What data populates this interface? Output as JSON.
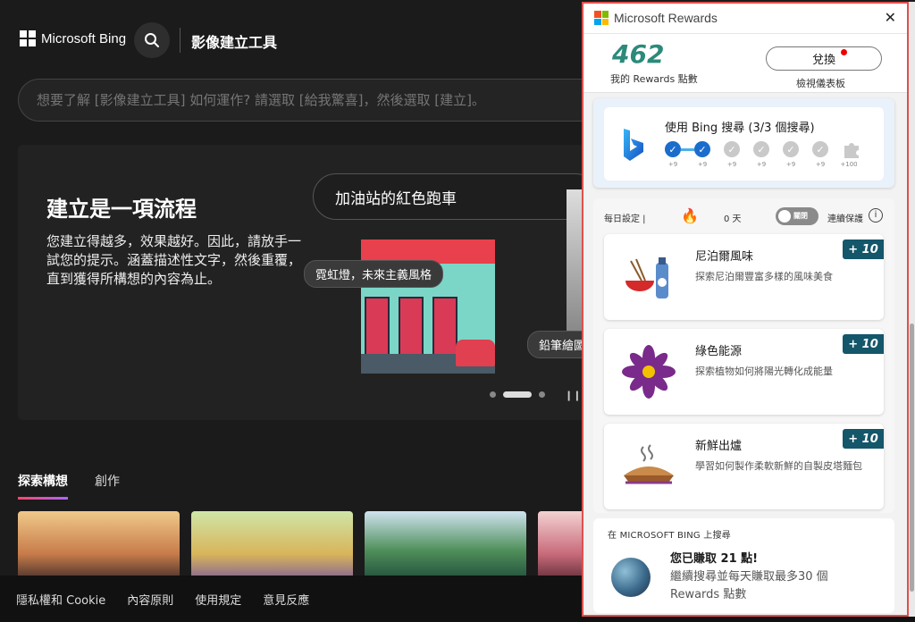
{
  "bing": {
    "logo_text": "Microsoft Bing",
    "tool_title": "影像建立工具",
    "prompt_placeholder": "想要了解 [影像建立工具] 如何運作? 請選取 [給我驚喜]，然後選取 [建立]。",
    "hero": {
      "title": "建立是一項流程",
      "description": "您建立得越多，效果越好。因此，請放手一試您的提示。涵蓋描述性文字，然後重覆，直到獲得所構想的內容為止。",
      "example_prompt": "加油站的紅色跑車",
      "chip_style": "霓虹燈，未來主義風格",
      "chip_style2": "鉛筆繪圖"
    },
    "tabs": [
      "探索構想",
      "創作"
    ],
    "footer": [
      "隱私權和 Cookie",
      "內容原則",
      "使用規定",
      "意見反應"
    ]
  },
  "rewards": {
    "title": "Microsoft Rewards",
    "points": "462",
    "points_label": "我的 Rewards 點數",
    "redeem_label": "兌換",
    "dashboard_label": "檢視儀表板",
    "search_card": {
      "title": "使用 Bing 搜尋 (3/3 個搜尋)",
      "steps_done": 2,
      "step_labels": [
        "+9",
        "+9",
        "+9",
        "+9",
        "+9",
        "+9",
        "+100"
      ]
    },
    "streak": {
      "label": "每日設定 |",
      "days": "0 天",
      "toggle_label": "關閉",
      "protection_label": "連續保護"
    },
    "offers": [
      {
        "badge": "+ 10",
        "title": "尼泊爾風味",
        "desc": "探索尼泊爾豐富多樣的風味美食"
      },
      {
        "badge": "+ 10",
        "title": "綠色能源",
        "desc": "探索植物如何將陽光轉化成能量"
      },
      {
        "badge": "+ 10",
        "title": "新鮮出爐",
        "desc": "學習如何製作柔軟新鮮的自製皮塔麵包"
      }
    ],
    "bing_card": {
      "header": "在 MICROSOFT BING 上搜尋",
      "earned": "您已賺取 21 點!",
      "keep": "繼續搜尋並每天賺取最多30 個 Rewards 點數"
    }
  }
}
